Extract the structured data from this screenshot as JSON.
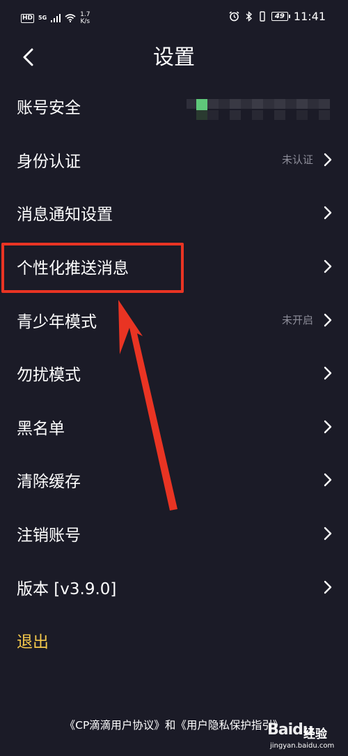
{
  "status_bar": {
    "hd": "HD",
    "network": "5G",
    "speed_value": "1.7",
    "speed_unit": "K/s",
    "battery": "49",
    "time": "11:41"
  },
  "header": {
    "title": "设置",
    "back_icon": "chevron-left-icon"
  },
  "settings": {
    "items": [
      {
        "label": "账号安全",
        "value": ""
      },
      {
        "label": "身份认证",
        "value": "未认证"
      },
      {
        "label": "消息通知设置",
        "value": ""
      },
      {
        "label": "个性化推送消息",
        "value": ""
      },
      {
        "label": "青少年模式",
        "value": "未开启"
      },
      {
        "label": "勿扰模式",
        "value": ""
      },
      {
        "label": "黑名单",
        "value": ""
      },
      {
        "label": "清除缓存",
        "value": ""
      },
      {
        "label": "注销账号",
        "value": ""
      },
      {
        "label": "版本 [v3.9.0]",
        "value": ""
      }
    ],
    "logout_label": "退出"
  },
  "footer": {
    "agreement_link": "《CP滴滴用户协议》",
    "connector": "和",
    "privacy_link": "《用户隐私保护指引》"
  },
  "watermark": {
    "brand": "Baidu",
    "sub": "经验",
    "url": "jingyan.baidu.com"
  },
  "colors": {
    "background": "#1b1b27",
    "text": "#ffffff",
    "muted": "#8d8d99",
    "logout": "#f3c84b",
    "annotation": "#e93423"
  }
}
